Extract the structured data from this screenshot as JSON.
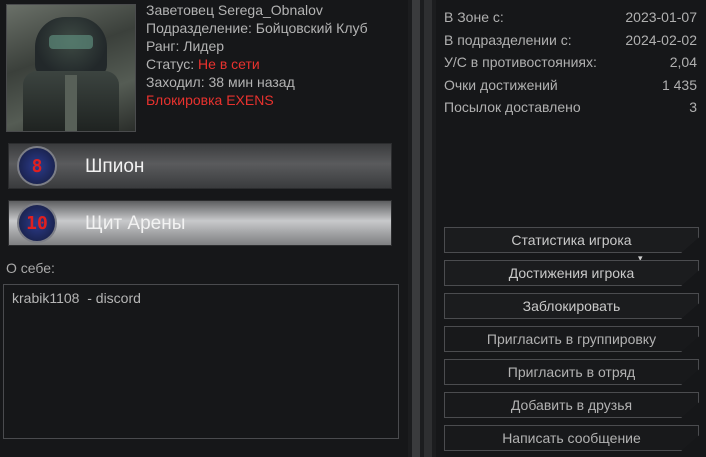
{
  "profile": {
    "name_line": "Заветовец Serega_Obnalov",
    "unit_line": "Подразделение: Бойцовский Клуб",
    "rank_line": "Ранг: Лидер",
    "status_label": "Статус: ",
    "status_value": "Не в сети",
    "visited_line": "Заходил: 38 мин назад",
    "block_line": "Блокировка EXENS",
    "status_color": "#e8322e"
  },
  "badges": [
    {
      "number": "8",
      "title": "Шпион"
    },
    {
      "number": "10",
      "title": "Щит Арены"
    }
  ],
  "about": {
    "label": "О себе:",
    "text": "krabik1108  - discord"
  },
  "stats": [
    {
      "label": "В Зоне с:",
      "value": "2023-01-07"
    },
    {
      "label": "В подразделении с:",
      "value": "2024-02-02"
    },
    {
      "label": "У/С в противостояниях:",
      "value": "2,04"
    },
    {
      "label": "Очки достижений",
      "value": "1 435"
    },
    {
      "label": "Посылок доставлено",
      "value": "3"
    }
  ],
  "buttons": {
    "player_stats": "Статистика игрока",
    "player_achievements": "Достижения игрока",
    "block": "Заблокировать",
    "invite_group": "Пригласить в группировку",
    "invite_squad": "Пригласить в отряд",
    "add_friends": "Добавить в друзья",
    "send_message": "Написать сообщение"
  }
}
